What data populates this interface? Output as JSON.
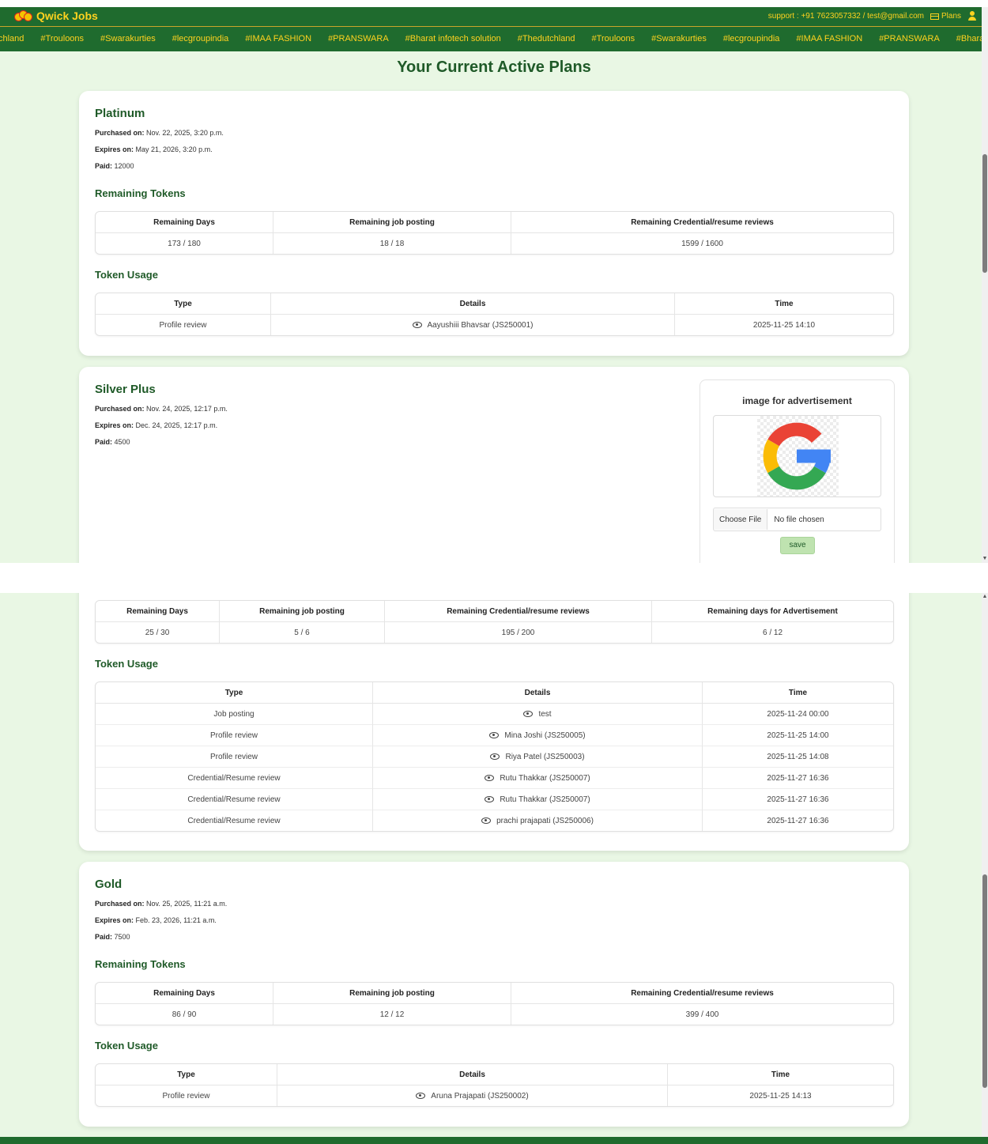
{
  "header": {
    "brand": "Qwick Jobs",
    "support": "support : +91 7623057332 / test@gmail.com",
    "plans_label": "Plans"
  },
  "ticker": [
    "chland",
    "#Trouloons",
    "#Swarakurties",
    "#lecgroupindia",
    "#IMAA FASHION",
    "#PRANSWARA",
    "#Bharat infotech solution",
    "#Thedutchland",
    "#Trouloons",
    "#Swarakurties",
    "#lecgroupindia",
    "#IMAA FASHION",
    "#PRANSWARA",
    "#Bharat int"
  ],
  "page_title": "Your Current Active Plans",
  "labels": {
    "purchased_on": "Purchased on:",
    "expires_on": "Expires on:",
    "paid": "Paid:",
    "remaining_tokens": "Remaining Tokens",
    "token_usage": "Token Usage"
  },
  "platinum": {
    "name": "Platinum",
    "purchased": "Nov. 22, 2025, 3:20 p.m.",
    "expires": "May 21, 2026, 3:20 p.m.",
    "paid": "12000",
    "tokens_headers": [
      "Remaining Days",
      "Remaining job posting",
      "Remaining Credential/resume reviews"
    ],
    "tokens_values": [
      "173 / 180",
      "18 / 18",
      "1599 / 1600"
    ],
    "usage_headers": [
      "Type",
      "Details",
      "Time"
    ],
    "usage_rows": [
      {
        "type": "Profile review",
        "details": "Aayushiii Bhavsar (JS250001)",
        "time": "2025-11-25 14:10"
      }
    ]
  },
  "silver_plus": {
    "name": "Silver Plus",
    "purchased": "Nov. 24, 2025, 12:17 p.m.",
    "expires": "Dec. 24, 2025, 12:17 p.m.",
    "paid": "4500",
    "ad": {
      "title": "image for advertisement",
      "choose_file": "Choose File",
      "no_file": "No file chosen",
      "save": "save"
    },
    "tokens_headers": [
      "Remaining Days",
      "Remaining job posting",
      "Remaining Credential/resume reviews",
      "Remaining days for Advertisement"
    ],
    "tokens_values": [
      "25 / 30",
      "5 / 6",
      "195 / 200",
      "6 / 12"
    ],
    "usage_headers": [
      "Type",
      "Details",
      "Time"
    ],
    "usage_rows": [
      {
        "type": "Job posting",
        "details": "test",
        "time": "2025-11-24 00:00"
      },
      {
        "type": "Profile review",
        "details": "Mina Joshi (JS250005)",
        "time": "2025-11-25 14:00"
      },
      {
        "type": "Profile review",
        "details": "Riya Patel (JS250003)",
        "time": "2025-11-25 14:08"
      },
      {
        "type": "Credential/Resume review",
        "details": "Rutu Thakkar (JS250007)",
        "time": "2025-11-27 16:36"
      },
      {
        "type": "Credential/Resume review",
        "details": "Rutu Thakkar (JS250007)",
        "time": "2025-11-27 16:36"
      },
      {
        "type": "Credential/Resume review",
        "details": "prachi prajapati (JS250006)",
        "time": "2025-11-27 16:36"
      }
    ]
  },
  "gold": {
    "name": "Gold",
    "purchased": "Nov. 25, 2025, 11:21 a.m.",
    "expires": "Feb. 23, 2026, 11:21 a.m.",
    "paid": "7500",
    "tokens_headers": [
      "Remaining Days",
      "Remaining job posting",
      "Remaining Credential/resume reviews"
    ],
    "tokens_values": [
      "86 / 90",
      "12 / 12",
      "399 / 400"
    ],
    "usage_headers": [
      "Type",
      "Details",
      "Time"
    ],
    "usage_rows": [
      {
        "type": "Profile review",
        "details": "Aruna Prajapati (JS250002)",
        "time": "2025-11-25 14:13"
      }
    ]
  },
  "colors": {
    "brand_green": "#1f6b2e",
    "accent_yellow": "#ffd21f",
    "page_bg": "#e9f7e4",
    "title_green": "#1f5a28"
  },
  "icons": [
    "qwick-jobs-logo-icon",
    "credit-card-icon",
    "user-icon",
    "eye-icon",
    "google-logo-icon"
  ]
}
